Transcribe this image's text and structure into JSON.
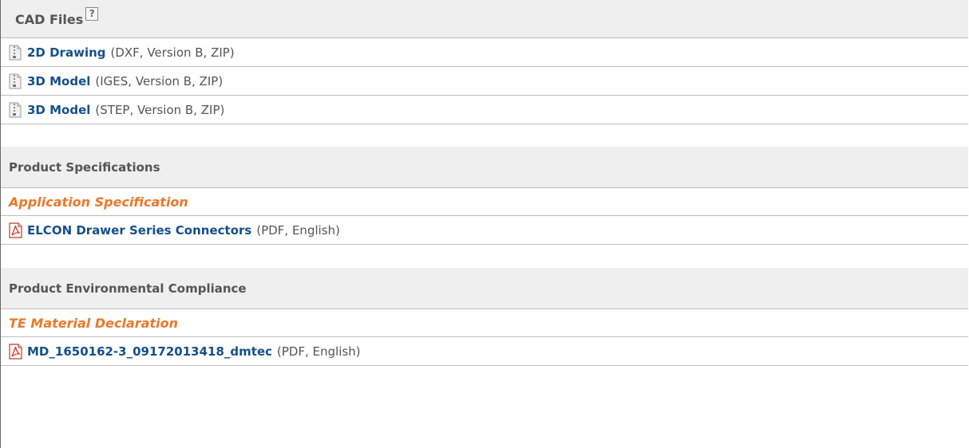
{
  "cad_files": {
    "title": "CAD Files",
    "help_glyph": "?",
    "items": [
      {
        "icon": "zip-file-icon",
        "label": "2D Drawing",
        "meta": "(DXF, Version B, ZIP)"
      },
      {
        "icon": "zip-file-icon",
        "label": "3D Model",
        "meta": "(IGES, Version B, ZIP)"
      },
      {
        "icon": "zip-file-icon",
        "label": "3D Model",
        "meta": "(STEP, Version B, ZIP)"
      }
    ]
  },
  "product_specifications": {
    "title": "Product Specifications",
    "subheading": "Application Specification",
    "items": [
      {
        "icon": "pdf-icon",
        "label": "ELCON Drawer Series Connectors",
        "meta": "(PDF, English)"
      }
    ]
  },
  "environmental_compliance": {
    "title": "Product Environmental Compliance",
    "subheading": "TE Material Declaration",
    "items": [
      {
        "icon": "pdf-icon",
        "label": "MD_1650162-3_09172013418_dmtec",
        "meta": "(PDF, English)"
      }
    ]
  },
  "colors": {
    "link": "#15508a",
    "subheading": "#e8792a",
    "header_bg": "#efefef",
    "text": "#555555"
  }
}
